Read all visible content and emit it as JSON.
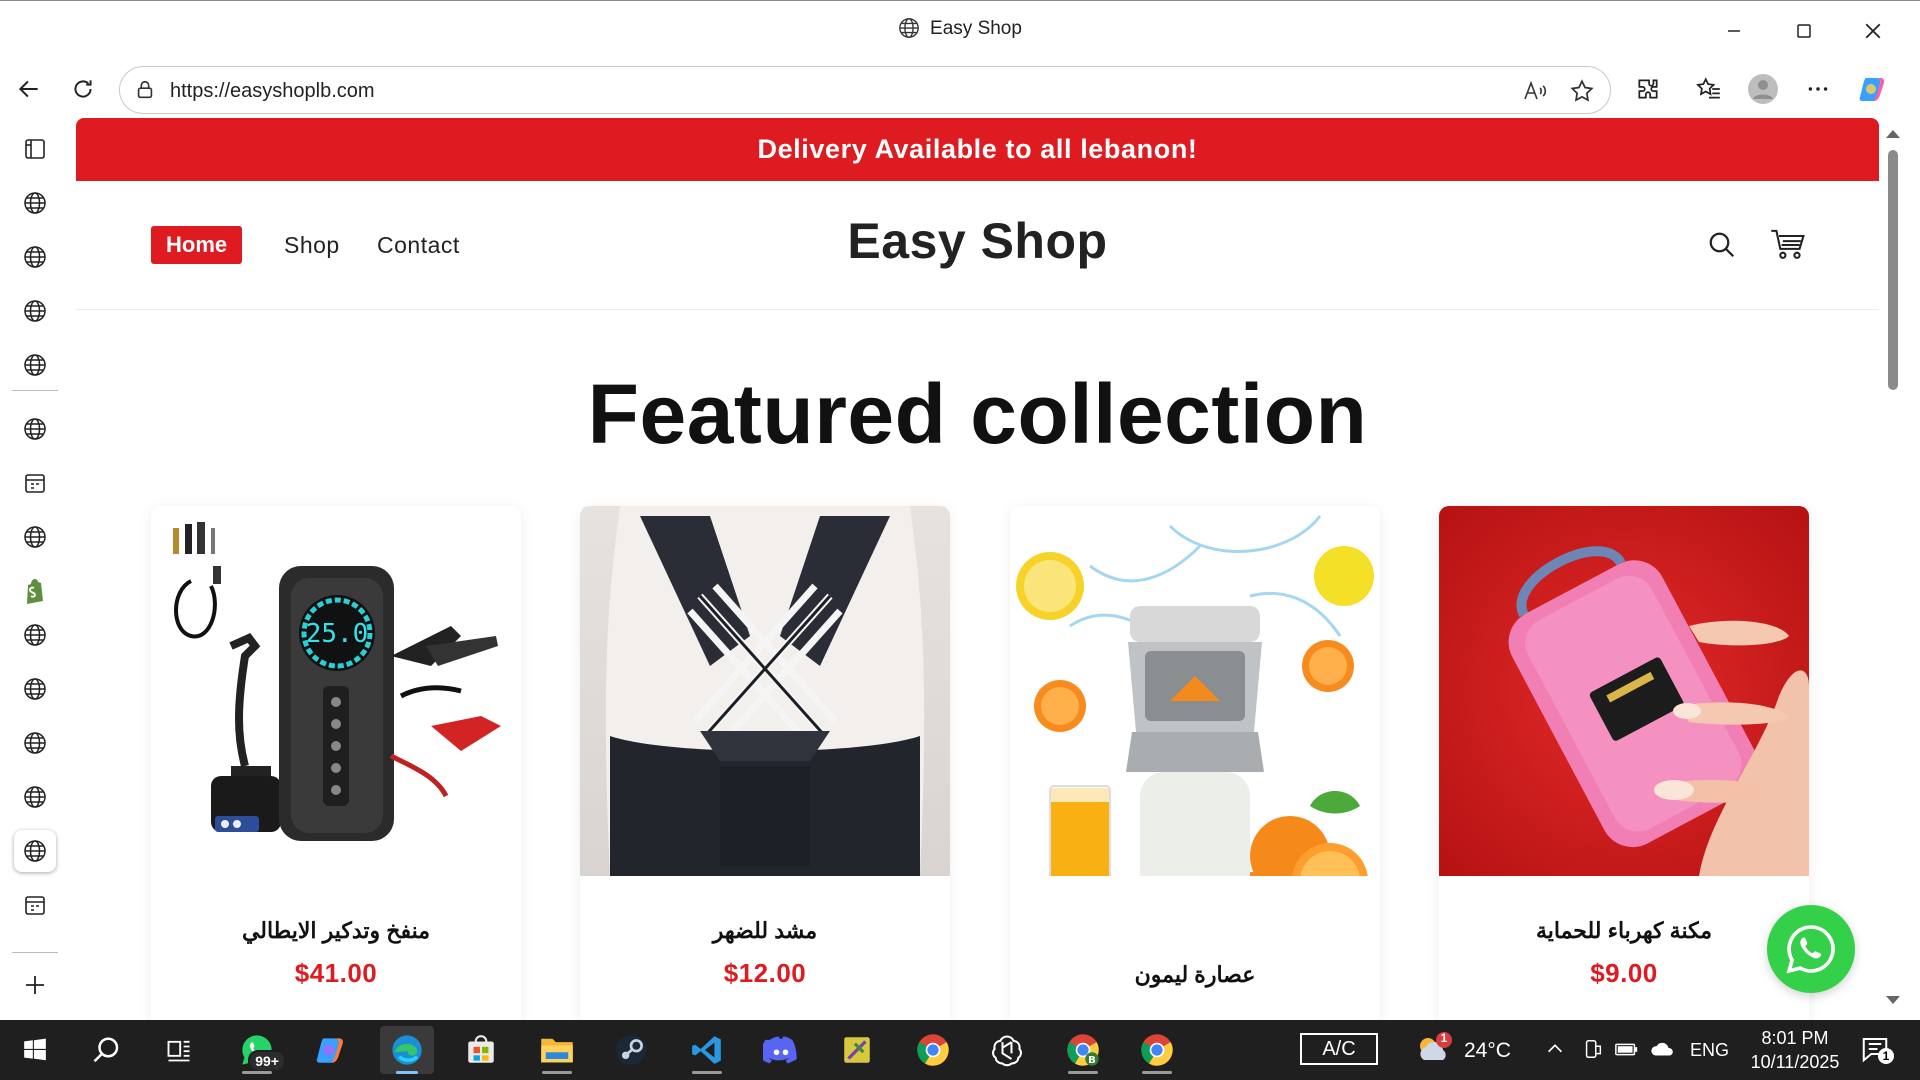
{
  "window": {
    "title": "Easy Shop",
    "minimize_icon": "minimize-icon",
    "maximize_icon": "maximize-icon",
    "close_icon": "close-icon"
  },
  "browser": {
    "url": "https://easyshoplb.com",
    "toolbar_icons": [
      "back-icon",
      "refresh-icon",
      "lock-icon",
      "read-aloud-icon",
      "favorite-star-icon",
      "extensions-icon",
      "favorites-icon",
      "profile-icon",
      "more-icon",
      "copilot-icon"
    ]
  },
  "sidebar": {
    "items": [
      "tab-actions-icon",
      "globe-icon",
      "globe-icon",
      "globe-icon",
      "globe-icon",
      "globe-icon",
      "calendar-icon",
      "globe-icon",
      "shopify-icon",
      "globe-icon",
      "globe-icon",
      "globe-icon",
      "globe-icon",
      "globe-icon",
      "calendar-icon",
      "new-tab-icon"
    ]
  },
  "site": {
    "announcement": "Delivery Available to all lebanon!",
    "nav": {
      "home": "Home",
      "shop": "Shop",
      "contact": "Contact"
    },
    "brand": "Easy Shop",
    "header_icons": [
      "search-icon",
      "cart-icon"
    ],
    "featured_title": "Featured collection",
    "products": [
      {
        "name": "منفخ وتدكير الايطالي",
        "price": "$41.00",
        "image": "jump-starter-inflator"
      },
      {
        "name": "مشد للضهر",
        "price": "$12.00",
        "image": "back-posture-brace"
      },
      {
        "name": "عصارة ليمون",
        "price": "",
        "image": "citrus-juicer"
      },
      {
        "name": "مكنة كهرباء للحماية",
        "price": "$9.00",
        "image": "pink-stun-device"
      }
    ],
    "whatsapp_icon": "whatsapp-icon"
  },
  "taskbar": {
    "apps": [
      "start-icon",
      "search-icon",
      "task-view-icon",
      "whatsapp-icon",
      "copilot-icon",
      "edge-icon",
      "store-icon",
      "file-explorer-icon",
      "steam-icon",
      "vscode-icon",
      "discord-icon",
      "sticky-app-icon",
      "chrome-icon",
      "chatgpt-icon",
      "chrome-profile-icon",
      "chrome-icon"
    ],
    "whatsapp_badge": "99+",
    "ac_label": "A/C",
    "weather_badge": "1",
    "temperature": "24°C",
    "language": "ENG",
    "time": "8:01 PM",
    "date": "10/11/2025",
    "notification_count": "1",
    "colors": {
      "taskbar_bg": "#1f1f1f",
      "accent_red": "#de1b20",
      "whatsapp_green": "#35d04a"
    }
  }
}
